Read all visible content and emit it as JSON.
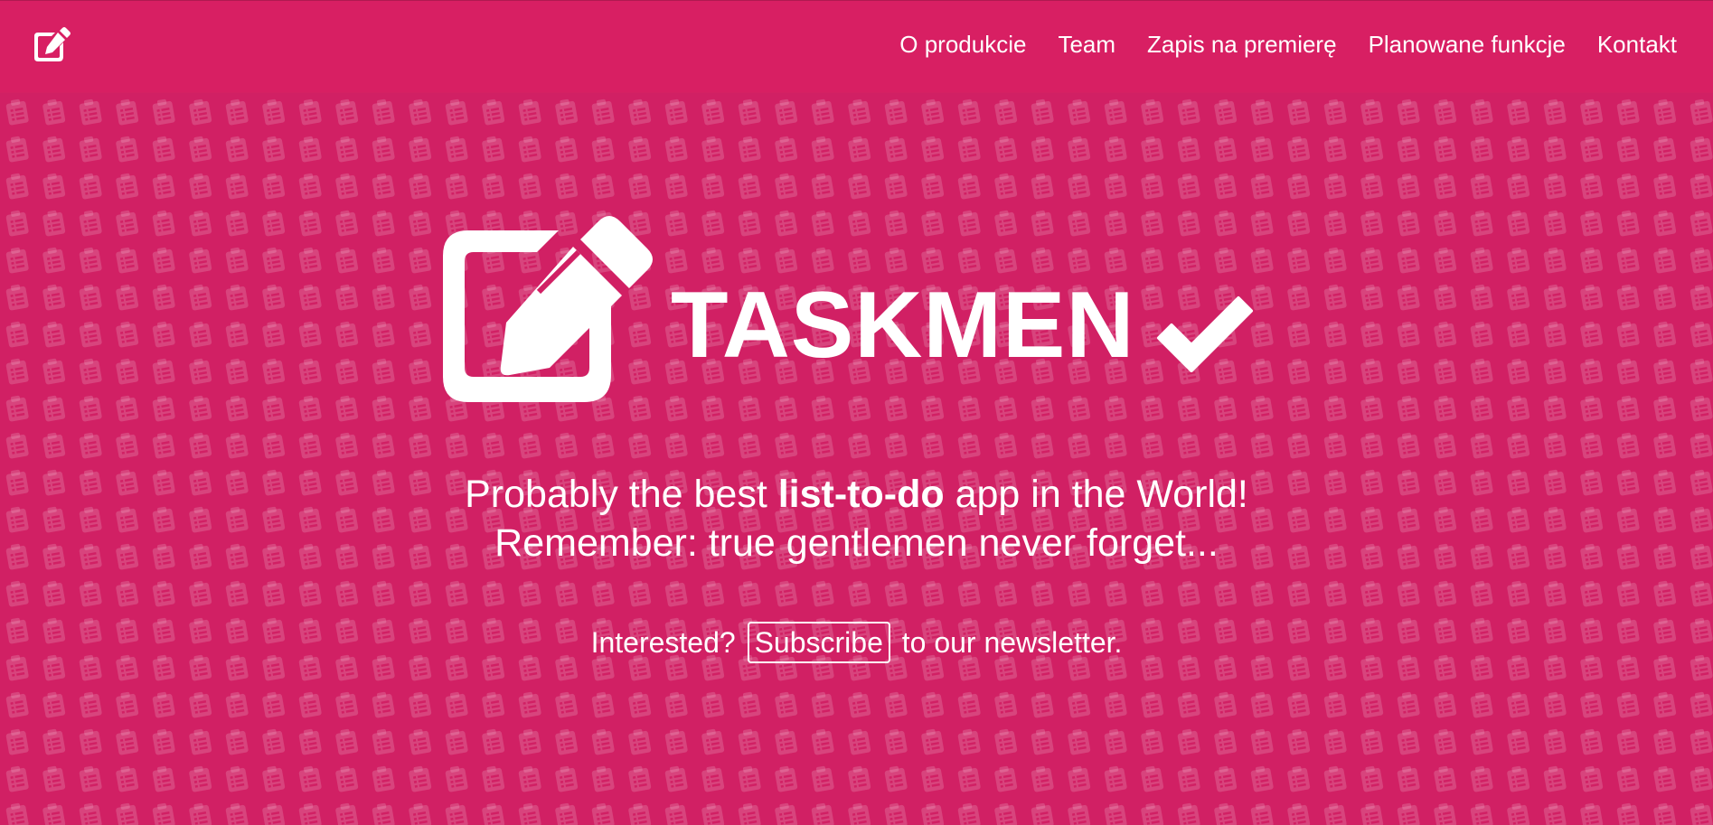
{
  "navbar": {
    "brand_icon": "edit-icon",
    "links": [
      {
        "label": "O produkcie"
      },
      {
        "label": "Team"
      },
      {
        "label": "Zapis na premierę"
      },
      {
        "label": "Planowane funkcje"
      },
      {
        "label": "Kontakt"
      }
    ]
  },
  "hero": {
    "logo_icon": "edit-icon",
    "title": "TASKMEN",
    "check_icon": "checkmark-icon",
    "tagline_prefix": "Probably the best ",
    "tagline_bold": "list-to-do",
    "tagline_suffix": " app in the World!",
    "tagline_line2": "Remember: true gentlemen never forget...",
    "cta_prefix": "Interested?",
    "subscribe_label": "Subscribe",
    "cta_suffix": "to our newsletter."
  },
  "colors": {
    "navbar_bg": "#d81f63",
    "hero_bg": "#d12064",
    "text": "#ffffff"
  }
}
